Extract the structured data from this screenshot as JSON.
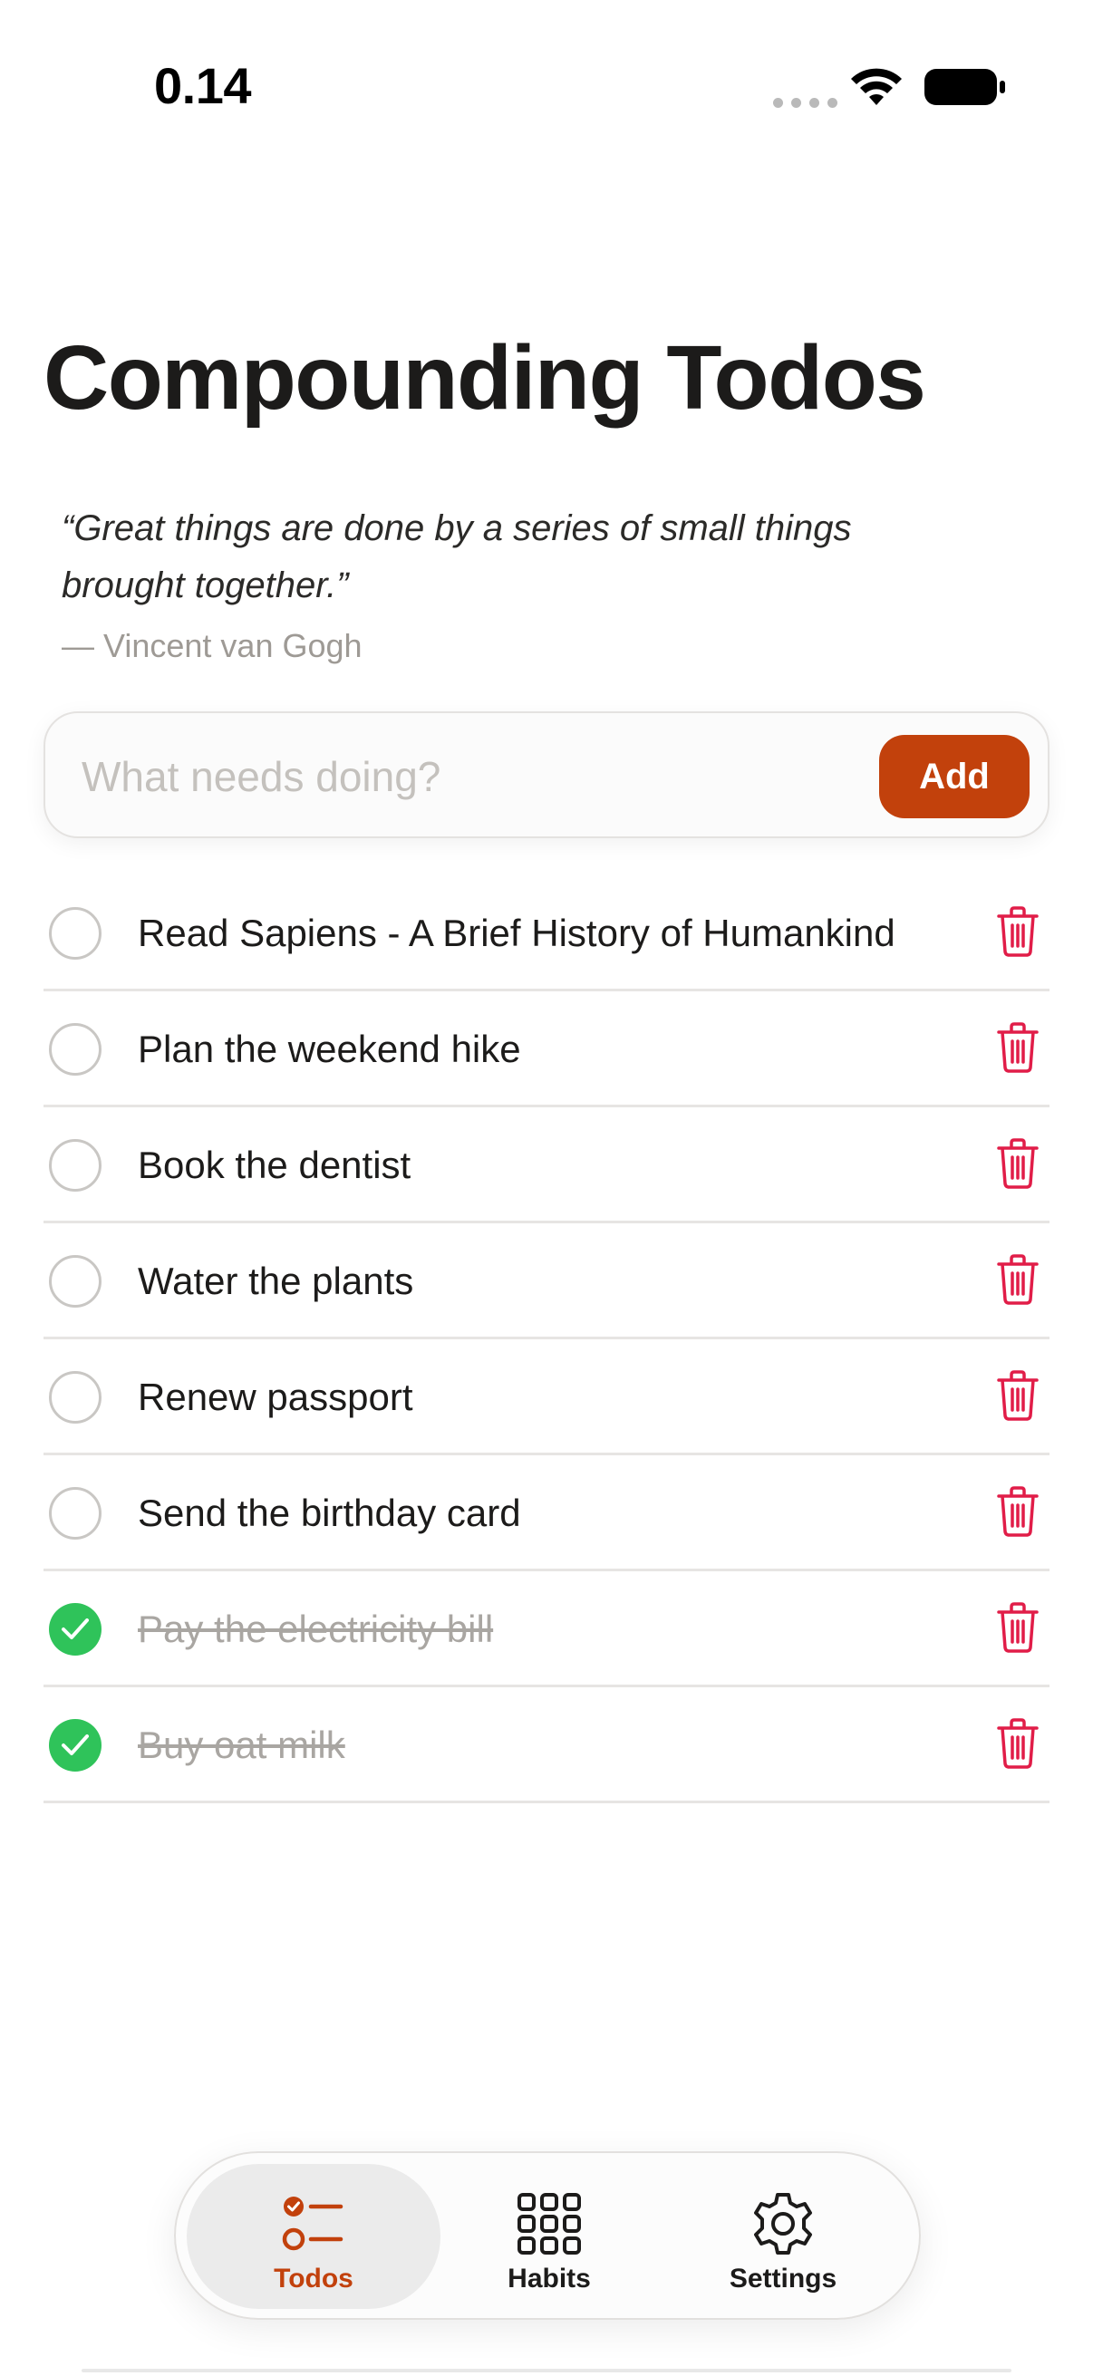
{
  "status_bar": {
    "time": "0.14"
  },
  "header": {
    "title": "Compounding Todos",
    "quote": "“Great things are done by a series of small things brought together.”",
    "quote_author": "— Vincent van Gogh"
  },
  "add_form": {
    "placeholder": "What needs doing?",
    "value": "",
    "button_label": "Add"
  },
  "todos": [
    {
      "text": "Read Sapiens - A Brief History of Humankind",
      "done": false
    },
    {
      "text": "Plan the weekend hike",
      "done": false
    },
    {
      "text": "Book the dentist",
      "done": false
    },
    {
      "text": "Water the plants",
      "done": false
    },
    {
      "text": "Renew passport",
      "done": false
    },
    {
      "text": "Send the birthday card",
      "done": false
    },
    {
      "text": "Pay the electricity bill",
      "done": true
    },
    {
      "text": "Buy oat milk",
      "done": true
    }
  ],
  "tab_bar": {
    "tabs": [
      {
        "label": "Todos",
        "icon": "checklist-icon",
        "active": true
      },
      {
        "label": "Habits",
        "icon": "grid-icon",
        "active": false
      },
      {
        "label": "Settings",
        "icon": "gear-icon",
        "active": false
      }
    ]
  },
  "colors": {
    "accent": "#c2410c",
    "done_check": "#2fc35a",
    "delete": "#e11d48",
    "muted_text": "#a9a6a2"
  },
  "icons": {
    "trash": "trash-icon",
    "check": "check-icon",
    "wifi": "wifi-icon",
    "battery": "battery-icon"
  }
}
